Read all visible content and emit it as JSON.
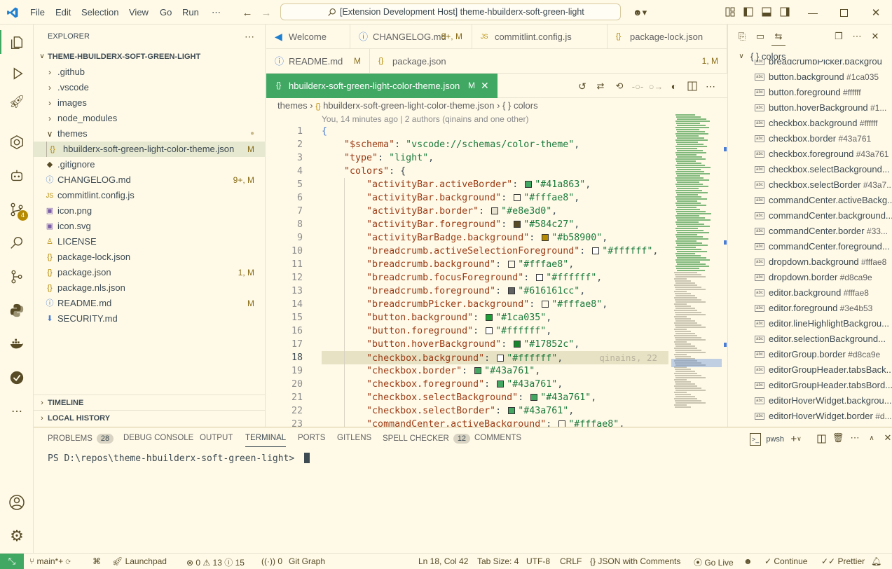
{
  "titlebar": {
    "menu": [
      "File",
      "Edit",
      "Selection",
      "View",
      "Go",
      "Run",
      "⋯"
    ],
    "search_text": "[Extension Development Host] theme-hbuilderx-soft-green-light"
  },
  "explorer": {
    "title": "EXPLORER",
    "root": "THEME-HBUILDERX-SOFT-GREEN-LIGHT",
    "items": [
      {
        "label": ".github",
        "kind": "folder",
        "status": ""
      },
      {
        "label": ".vscode",
        "kind": "folder",
        "status": ""
      },
      {
        "label": "images",
        "kind": "folder",
        "status": ""
      },
      {
        "label": "node_modules",
        "kind": "folder",
        "status": ""
      },
      {
        "label": "themes",
        "kind": "folder-open",
        "status": "●"
      },
      {
        "label": "hbuilderx-soft-green-light-color-theme.json",
        "kind": "json",
        "status": "M"
      },
      {
        "label": ".gitignore",
        "kind": "git",
        "status": ""
      },
      {
        "label": "CHANGELOG.md",
        "kind": "md",
        "status": "9+, M"
      },
      {
        "label": "commitlint.config.js",
        "kind": "js",
        "status": ""
      },
      {
        "label": "icon.png",
        "kind": "img",
        "status": ""
      },
      {
        "label": "icon.svg",
        "kind": "svg",
        "status": ""
      },
      {
        "label": "LICENSE",
        "kind": "license",
        "status": ""
      },
      {
        "label": "package-lock.json",
        "kind": "json",
        "status": ""
      },
      {
        "label": "package.json",
        "kind": "json",
        "status": "1, M"
      },
      {
        "label": "package.nls.json",
        "kind": "json",
        "status": ""
      },
      {
        "label": "README.md",
        "kind": "info",
        "status": "M"
      },
      {
        "label": "SECURITY.md",
        "kind": "sec",
        "status": ""
      }
    ],
    "timeline": "TIMELINE",
    "local_history": "LOCAL HISTORY"
  },
  "tabs": {
    "row1": [
      {
        "label": "Welcome",
        "icon": "vscode-icon",
        "mod": ""
      },
      {
        "label": "CHANGELOG.md",
        "icon": "info-icon",
        "mod": "9+, M"
      },
      {
        "label": "commitlint.config.js",
        "icon": "js-icon",
        "mod": ""
      },
      {
        "label": "package-lock.json",
        "icon": "json-icon",
        "mod": ""
      }
    ],
    "row2": [
      {
        "label": "README.md",
        "icon": "info-icon",
        "mod": "M"
      },
      {
        "label": "package.json",
        "icon": "json-icon",
        "mod": "1, M"
      }
    ],
    "active": {
      "label": "hbuilderx-soft-green-light-color-theme.json",
      "mod": "M"
    }
  },
  "breadcrumb": {
    "a": "themes",
    "b": "hbuilderx-soft-green-light-color-theme.json",
    "c": "colors"
  },
  "blame": "You, 14 minutes ago | 2 authors (qinains and one other)",
  "inline_blame": "qinains, 22",
  "code": [
    {
      "n": "1",
      "t": "{"
    },
    {
      "n": "2",
      "key": "\"$schema\"",
      "val": "\"vscode://schemas/color-theme\"",
      "indent": 1,
      "comma": true
    },
    {
      "n": "3",
      "key": "\"type\"",
      "val": "\"light\"",
      "indent": 1,
      "comma": true
    },
    {
      "n": "4",
      "key": "\"colors\"",
      "val": "{",
      "indent": 1,
      "raw": true
    },
    {
      "n": "5",
      "key": "\"activityBar.activeBorder\"",
      "val": "\"#41a863\"",
      "sw": "#41a863",
      "indent": 2,
      "comma": true
    },
    {
      "n": "6",
      "key": "\"activityBar.background\"",
      "val": "\"#fffae8\"",
      "sw": "#fffae8",
      "indent": 2,
      "comma": true
    },
    {
      "n": "7",
      "key": "\"activityBar.border\"",
      "val": "\"#e8e3d0\"",
      "sw": "#e8e3d0",
      "indent": 2,
      "comma": true
    },
    {
      "n": "8",
      "key": "\"activityBar.foreground\"",
      "val": "\"#584c27\"",
      "sw": "#584c27",
      "indent": 2,
      "comma": true
    },
    {
      "n": "9",
      "key": "\"activityBarBadge.background\"",
      "val": "\"#b58900\"",
      "sw": "#b58900",
      "indent": 2,
      "comma": true
    },
    {
      "n": "10",
      "key": "\"breadcrumb.activeSelectionForeground\"",
      "val": "\"#ffffff\"",
      "sw": "#ffffff",
      "indent": 2,
      "comma": true
    },
    {
      "n": "11",
      "key": "\"breadcrumb.background\"",
      "val": "\"#fffae8\"",
      "sw": "#fffae8",
      "indent": 2,
      "comma": true
    },
    {
      "n": "12",
      "key": "\"breadcrumb.focusForeground\"",
      "val": "\"#ffffff\"",
      "sw": "#ffffff",
      "indent": 2,
      "comma": true
    },
    {
      "n": "13",
      "key": "\"breadcrumb.foreground\"",
      "val": "\"#616161cc\"",
      "sw": "#616161",
      "indent": 2,
      "comma": true
    },
    {
      "n": "14",
      "key": "\"breadcrumbPicker.background\"",
      "val": "\"#fffae8\"",
      "sw": "#fffae8",
      "indent": 2,
      "comma": true
    },
    {
      "n": "15",
      "key": "\"button.background\"",
      "val": "\"#1ca035\"",
      "sw": "#1ca035",
      "indent": 2,
      "comma": true
    },
    {
      "n": "16",
      "key": "\"button.foreground\"",
      "val": "\"#ffffff\"",
      "sw": "#ffffff",
      "indent": 2,
      "comma": true
    },
    {
      "n": "17",
      "key": "\"button.hoverBackground\"",
      "val": "\"#17852c\"",
      "sw": "#17852c",
      "indent": 2,
      "comma": true
    },
    {
      "n": "18",
      "key": "\"checkbox.background\"",
      "val": "\"#ffffff\"",
      "sw": "#ffffff",
      "indent": 2,
      "comma": true,
      "current": true
    },
    {
      "n": "19",
      "key": "\"checkbox.border\"",
      "val": "\"#43a761\"",
      "sw": "#43a761",
      "indent": 2,
      "comma": true
    },
    {
      "n": "20",
      "key": "\"checkbox.foreground\"",
      "val": "\"#43a761\"",
      "sw": "#43a761",
      "indent": 2,
      "comma": true
    },
    {
      "n": "21",
      "key": "\"checkbox.selectBackground\"",
      "val": "\"#43a761\"",
      "sw": "#43a761",
      "indent": 2,
      "comma": true
    },
    {
      "n": "22",
      "key": "\"checkbox.selectBorder\"",
      "val": "\"#43a761\"",
      "sw": "#43a761",
      "indent": 2,
      "comma": true
    },
    {
      "n": "23",
      "key": "\"commandCenter.activeBackground\"",
      "val": "\"#fffae8\"",
      "sw": "#fffae8",
      "indent": 2,
      "comma": true
    }
  ],
  "outline": {
    "header": "{ } colors",
    "items": [
      {
        "label": "breadcrumbPicker.backgrou",
        "value": ""
      },
      {
        "label": "button.background",
        "value": "#1ca035"
      },
      {
        "label": "button.foreground",
        "value": "#ffffff"
      },
      {
        "label": "button.hoverBackground",
        "value": "#1..."
      },
      {
        "label": "checkbox.background",
        "value": "#ffffff"
      },
      {
        "label": "checkbox.border",
        "value": "#43a761"
      },
      {
        "label": "checkbox.foreground",
        "value": "#43a761"
      },
      {
        "label": "checkbox.selectBackground...",
        "value": ""
      },
      {
        "label": "checkbox.selectBorder",
        "value": "#43a7..."
      },
      {
        "label": "commandCenter.activeBackg...",
        "value": ""
      },
      {
        "label": "commandCenter.background...",
        "value": ""
      },
      {
        "label": "commandCenter.border",
        "value": "#33..."
      },
      {
        "label": "commandCenter.foreground...",
        "value": ""
      },
      {
        "label": "dropdown.background",
        "value": "#fffae8"
      },
      {
        "label": "dropdown.border",
        "value": "#d8ca9e"
      },
      {
        "label": "editor.background",
        "value": "#fffae8"
      },
      {
        "label": "editor.foreground",
        "value": "#3e4b53"
      },
      {
        "label": "editor.lineHighlightBackgrou...",
        "value": ""
      },
      {
        "label": "editor.selectionBackground...",
        "value": ""
      },
      {
        "label": "editorGroup.border",
        "value": "#d8ca9e"
      },
      {
        "label": "editorGroupHeader.tabsBack...",
        "value": ""
      },
      {
        "label": "editorGroupHeader.tabsBord...",
        "value": ""
      },
      {
        "label": "editorHoverWidget.backgrou...",
        "value": ""
      },
      {
        "label": "editorHoverWidget.border",
        "value": "#d..."
      }
    ]
  },
  "panel": {
    "tabs": [
      {
        "label": "PROBLEMS",
        "badge": "28"
      },
      {
        "label": "DEBUG CONSOLE",
        "badge": ""
      },
      {
        "label": "OUTPUT",
        "badge": ""
      },
      {
        "label": "TERMINAL",
        "badge": ""
      },
      {
        "label": "PORTS",
        "badge": ""
      },
      {
        "label": "GITLENS",
        "badge": ""
      },
      {
        "label": "SPELL CHECKER",
        "badge": "12"
      },
      {
        "label": "COMMENTS",
        "badge": ""
      }
    ],
    "shell": "pwsh",
    "prompt": "PS D:\\repos\\theme-hbuilderx-soft-green-light>"
  },
  "status": {
    "branch": "main*+",
    "launchpad": "Launchpad",
    "errors": "0",
    "warnings": "13",
    "infos": "15",
    "ports": "0",
    "gitgraph": "Git Graph",
    "position": "Ln 18, Col 42",
    "tabsize": "Tab Size: 4",
    "encoding": "UTF-8",
    "eol": "CRLF",
    "language": "JSON with Comments",
    "golive": "Go Live",
    "continue": "Continue",
    "prettier": "Prettier"
  },
  "scm_badge": "4",
  "colors": {
    "accent": "#41a863",
    "bg": "#fffae8",
    "badge": "#b58900"
  }
}
